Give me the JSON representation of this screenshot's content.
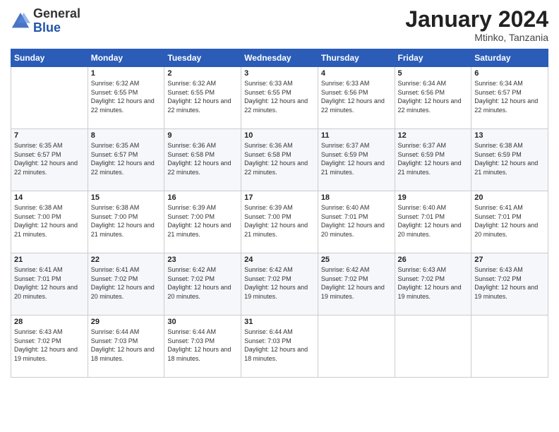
{
  "logo": {
    "general": "General",
    "blue": "Blue"
  },
  "header": {
    "title": "January 2024",
    "location": "Mtinko, Tanzania"
  },
  "weekdays": [
    "Sunday",
    "Monday",
    "Tuesday",
    "Wednesday",
    "Thursday",
    "Friday",
    "Saturday"
  ],
  "weeks": [
    [
      {
        "day": "",
        "content": ""
      },
      {
        "day": "1",
        "content": "Sunrise: 6:32 AM\nSunset: 6:55 PM\nDaylight: 12 hours and 22 minutes."
      },
      {
        "day": "2",
        "content": "Sunrise: 6:32 AM\nSunset: 6:55 PM\nDaylight: 12 hours and 22 minutes."
      },
      {
        "day": "3",
        "content": "Sunrise: 6:33 AM\nSunset: 6:55 PM\nDaylight: 12 hours and 22 minutes."
      },
      {
        "day": "4",
        "content": "Sunrise: 6:33 AM\nSunset: 6:56 PM\nDaylight: 12 hours and 22 minutes."
      },
      {
        "day": "5",
        "content": "Sunrise: 6:34 AM\nSunset: 6:56 PM\nDaylight: 12 hours and 22 minutes."
      },
      {
        "day": "6",
        "content": "Sunrise: 6:34 AM\nSunset: 6:57 PM\nDaylight: 12 hours and 22 minutes."
      }
    ],
    [
      {
        "day": "7",
        "content": "Sunrise: 6:35 AM\nSunset: 6:57 PM\nDaylight: 12 hours and 22 minutes."
      },
      {
        "day": "8",
        "content": "Sunrise: 6:35 AM\nSunset: 6:57 PM\nDaylight: 12 hours and 22 minutes."
      },
      {
        "day": "9",
        "content": "Sunrise: 6:36 AM\nSunset: 6:58 PM\nDaylight: 12 hours and 22 minutes."
      },
      {
        "day": "10",
        "content": "Sunrise: 6:36 AM\nSunset: 6:58 PM\nDaylight: 12 hours and 22 minutes."
      },
      {
        "day": "11",
        "content": "Sunrise: 6:37 AM\nSunset: 6:59 PM\nDaylight: 12 hours and 21 minutes."
      },
      {
        "day": "12",
        "content": "Sunrise: 6:37 AM\nSunset: 6:59 PM\nDaylight: 12 hours and 21 minutes."
      },
      {
        "day": "13",
        "content": "Sunrise: 6:38 AM\nSunset: 6:59 PM\nDaylight: 12 hours and 21 minutes."
      }
    ],
    [
      {
        "day": "14",
        "content": "Sunrise: 6:38 AM\nSunset: 7:00 PM\nDaylight: 12 hours and 21 minutes."
      },
      {
        "day": "15",
        "content": "Sunrise: 6:38 AM\nSunset: 7:00 PM\nDaylight: 12 hours and 21 minutes."
      },
      {
        "day": "16",
        "content": "Sunrise: 6:39 AM\nSunset: 7:00 PM\nDaylight: 12 hours and 21 minutes."
      },
      {
        "day": "17",
        "content": "Sunrise: 6:39 AM\nSunset: 7:00 PM\nDaylight: 12 hours and 21 minutes."
      },
      {
        "day": "18",
        "content": "Sunrise: 6:40 AM\nSunset: 7:01 PM\nDaylight: 12 hours and 20 minutes."
      },
      {
        "day": "19",
        "content": "Sunrise: 6:40 AM\nSunset: 7:01 PM\nDaylight: 12 hours and 20 minutes."
      },
      {
        "day": "20",
        "content": "Sunrise: 6:41 AM\nSunset: 7:01 PM\nDaylight: 12 hours and 20 minutes."
      }
    ],
    [
      {
        "day": "21",
        "content": "Sunrise: 6:41 AM\nSunset: 7:01 PM\nDaylight: 12 hours and 20 minutes."
      },
      {
        "day": "22",
        "content": "Sunrise: 6:41 AM\nSunset: 7:02 PM\nDaylight: 12 hours and 20 minutes."
      },
      {
        "day": "23",
        "content": "Sunrise: 6:42 AM\nSunset: 7:02 PM\nDaylight: 12 hours and 20 minutes."
      },
      {
        "day": "24",
        "content": "Sunrise: 6:42 AM\nSunset: 7:02 PM\nDaylight: 12 hours and 19 minutes."
      },
      {
        "day": "25",
        "content": "Sunrise: 6:42 AM\nSunset: 7:02 PM\nDaylight: 12 hours and 19 minutes."
      },
      {
        "day": "26",
        "content": "Sunrise: 6:43 AM\nSunset: 7:02 PM\nDaylight: 12 hours and 19 minutes."
      },
      {
        "day": "27",
        "content": "Sunrise: 6:43 AM\nSunset: 7:02 PM\nDaylight: 12 hours and 19 minutes."
      }
    ],
    [
      {
        "day": "28",
        "content": "Sunrise: 6:43 AM\nSunset: 7:02 PM\nDaylight: 12 hours and 19 minutes."
      },
      {
        "day": "29",
        "content": "Sunrise: 6:44 AM\nSunset: 7:03 PM\nDaylight: 12 hours and 18 minutes."
      },
      {
        "day": "30",
        "content": "Sunrise: 6:44 AM\nSunset: 7:03 PM\nDaylight: 12 hours and 18 minutes."
      },
      {
        "day": "31",
        "content": "Sunrise: 6:44 AM\nSunset: 7:03 PM\nDaylight: 12 hours and 18 minutes."
      },
      {
        "day": "",
        "content": ""
      },
      {
        "day": "",
        "content": ""
      },
      {
        "day": "",
        "content": ""
      }
    ]
  ]
}
